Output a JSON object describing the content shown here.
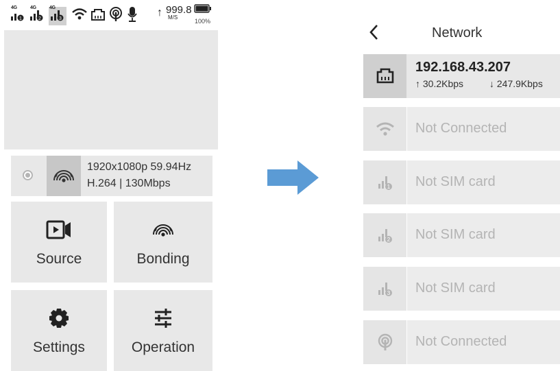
{
  "left_screen": {
    "status_bar": {
      "sims": [
        {
          "tag": "4G",
          "slot": "1"
        },
        {
          "tag": "4G",
          "slot": "2"
        },
        {
          "tag": "4G",
          "slot": "3"
        }
      ],
      "upload_speed": "999.8",
      "speed_unit": "M/S",
      "battery_percent": "100%",
      "battery_level": 1.0
    },
    "stream": {
      "resolution": "1920x1080p 59.94Hz",
      "codec": "H.264 | 130Mbps"
    },
    "tiles": [
      {
        "label": "Source",
        "icon": "video-camera-icon"
      },
      {
        "label": "Bonding",
        "icon": "bonding-icon"
      },
      {
        "label": "Settings",
        "icon": "gear-icon"
      },
      {
        "label": "Operation",
        "icon": "sliders-icon"
      }
    ]
  },
  "right_screen": {
    "title": "Network",
    "ethernet": {
      "ip": "192.168.43.207",
      "upload": "↑ 30.2Kbps",
      "download": "↓ 247.9Kbps"
    },
    "rows": [
      {
        "icon": "wifi-icon",
        "status": "Not Connected"
      },
      {
        "icon": "sim-1-icon",
        "status": "Not SIM card"
      },
      {
        "icon": "sim-2-icon",
        "status": "Not SIM card"
      },
      {
        "icon": "sim-3-icon",
        "status": "Not SIM card"
      },
      {
        "icon": "hotspot-icon",
        "status": "Not Connected"
      }
    ]
  },
  "colors": {
    "tile_bg": "#e8e8e8",
    "active_icon_bg": "#cfcfcf",
    "arrow": "#5b9bd5",
    "dim_text": "#b4b4b4"
  }
}
